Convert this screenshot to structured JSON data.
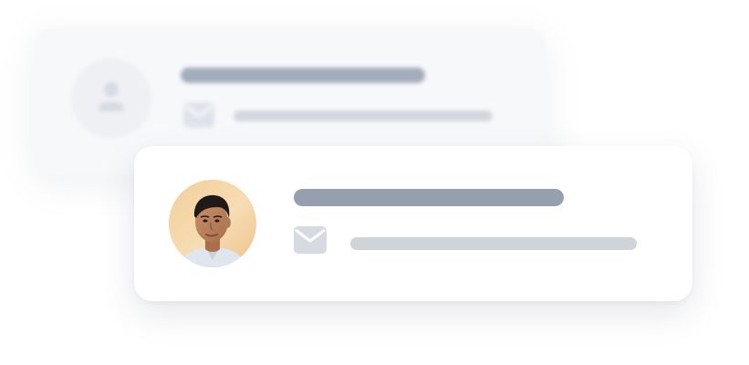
{
  "cards": [
    {
      "role": "background-placeholder",
      "avatar": "user-placeholder-icon",
      "contact_icon": "envelope-icon",
      "text_placeholders": 2
    },
    {
      "role": "foreground-contact",
      "avatar": "profile-photo",
      "contact_icon": "envelope-icon",
      "text_placeholders": 2
    }
  ],
  "colors": {
    "title_placeholder": "#959fae",
    "subtitle_placeholder": "#cfd4db",
    "icon": "#d6dbe2",
    "card_background": "#ffffff",
    "back_card_background": "#f7f8fa"
  }
}
